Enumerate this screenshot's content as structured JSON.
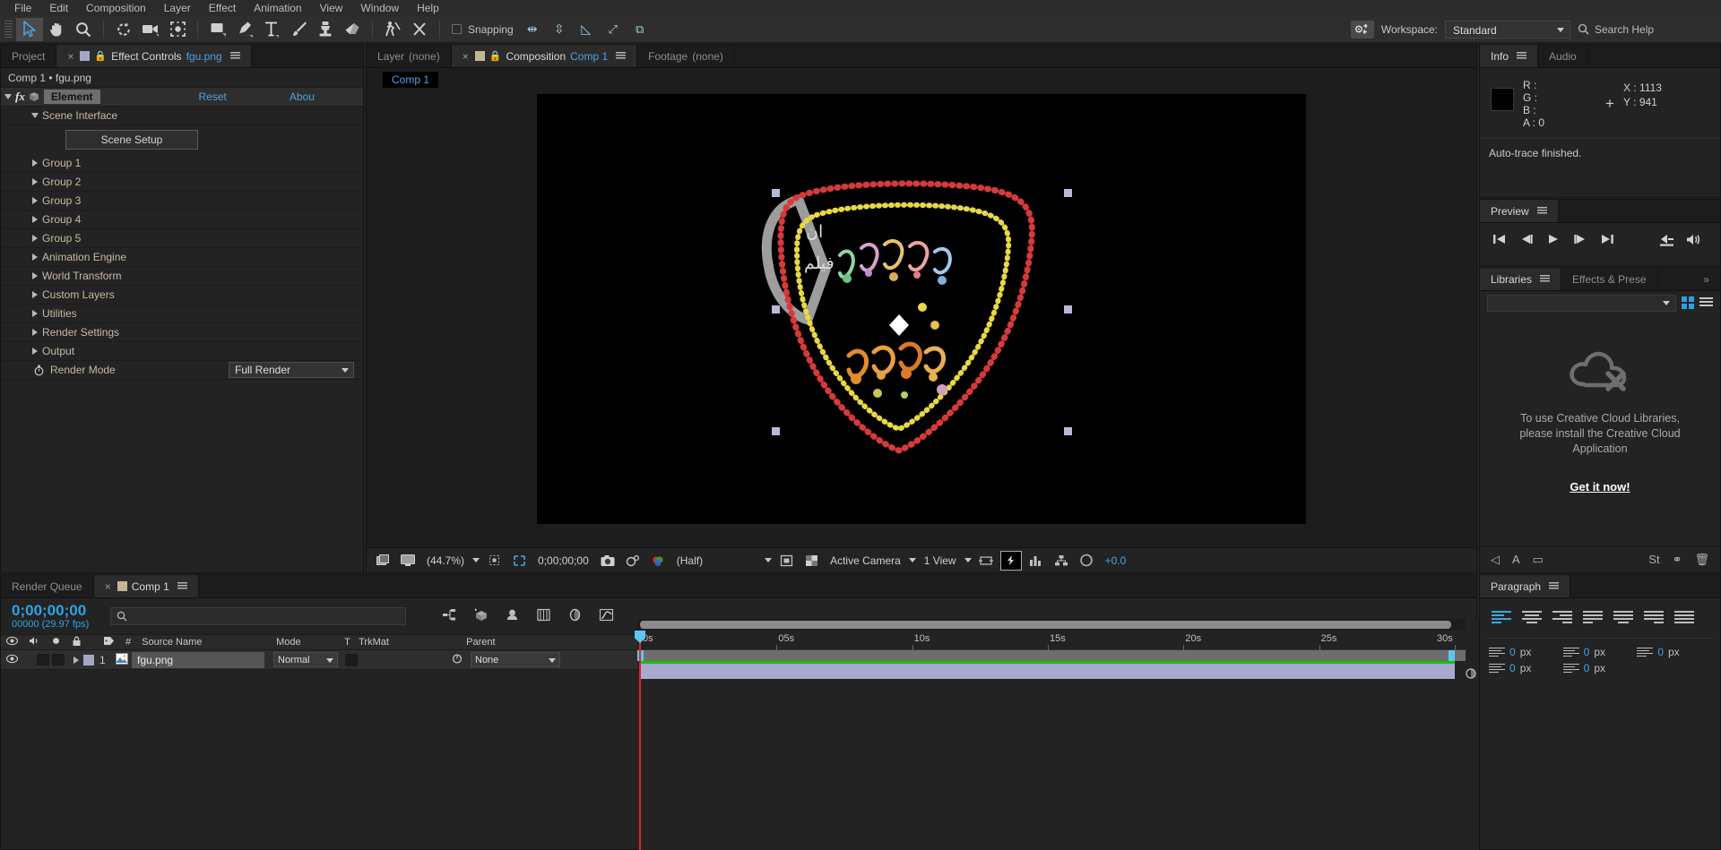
{
  "menubar": {
    "items": [
      "File",
      "Edit",
      "Composition",
      "Layer",
      "Effect",
      "Animation",
      "View",
      "Window",
      "Help"
    ]
  },
  "toolbar": {
    "tools": [
      {
        "name": "selection-tool",
        "glyph": "➤",
        "selected": true
      },
      {
        "name": "hand-tool",
        "glyph": "✋",
        "selected": false
      },
      {
        "name": "zoom-tool",
        "glyph": "🔍",
        "selected": false
      },
      {
        "name": "rotation-tool",
        "glyph": "↻",
        "selected": false
      },
      {
        "name": "camera-tool",
        "glyph": "🎥",
        "selected": false
      },
      {
        "name": "pan-behind-tool",
        "glyph": "⛶",
        "selected": false
      },
      {
        "name": "shape-tool",
        "glyph": "▭",
        "selected": false
      },
      {
        "name": "pen-tool",
        "glyph": "✒",
        "selected": false
      },
      {
        "name": "type-tool",
        "glyph": "T",
        "selected": false
      },
      {
        "name": "brush-tool",
        "glyph": "🖌",
        "selected": false
      },
      {
        "name": "clone-stamp-tool",
        "glyph": "⬍",
        "selected": false
      },
      {
        "name": "eraser-tool",
        "glyph": "▰",
        "selected": false
      },
      {
        "name": "roto-brush-tool",
        "glyph": "🏃",
        "selected": false
      },
      {
        "name": "puppet-pin-tool",
        "glyph": "✛",
        "selected": false
      }
    ],
    "snapping_label": "Snapping",
    "align_tools": [
      {
        "name": "align-tool",
        "glyph": "⇹"
      },
      {
        "name": "distribute-tool",
        "glyph": "⇳"
      },
      {
        "name": "mask-tool",
        "glyph": "◺"
      }
    ],
    "snap_extra": [
      {
        "name": "snap-to-grid-icon",
        "glyph": "⤢"
      },
      {
        "name": "snap-boundaries-icon",
        "glyph": "⧉"
      }
    ],
    "workspace_label": "Workspace:",
    "workspace_value": "Standard",
    "search_placeholder": "Search Help"
  },
  "effect_controls": {
    "tabs": [
      {
        "label": "Project",
        "active": false
      },
      {
        "label": "Effect Controls",
        "suffix": "fgu.png",
        "active": true
      }
    ],
    "breadcrumb": "Comp 1 • fgu.png",
    "effect_name": "Element",
    "reset_label": "Reset",
    "about_label": "Abou",
    "scene_interface_label": "Scene Interface",
    "scene_setup_button": "Scene Setup",
    "groups": [
      "Group 1",
      "Group 2",
      "Group 3",
      "Group 4",
      "Group 5",
      "Animation Engine",
      "World Transform",
      "Custom Layers",
      "Utilities",
      "Render Settings",
      "Output"
    ],
    "render_mode_label": "Render Mode",
    "render_mode_value": "Full Render"
  },
  "composition": {
    "tabs": [
      {
        "label": "Layer",
        "suffix": "(none)",
        "active": false
      },
      {
        "label": "Composition",
        "suffix": "Comp 1",
        "active": true
      },
      {
        "label": "Footage",
        "suffix": "(none)",
        "active": false
      }
    ],
    "subtab": "Comp 1",
    "bottom_bar": {
      "zoom": "(44.7%)",
      "timecode": "0;00;00;00",
      "resolution": "(Half)",
      "camera": "Active Camera",
      "views": "1 View",
      "exposure": "+0.0"
    }
  },
  "info": {
    "tabs": [
      {
        "label": "Info",
        "active": true
      },
      {
        "label": "Audio",
        "active": false
      }
    ],
    "channels": [
      {
        "key": "R :",
        "value": ""
      },
      {
        "key": "G :",
        "value": ""
      },
      {
        "key": "B :",
        "value": ""
      },
      {
        "key": "A :",
        "value": "0"
      }
    ],
    "x_label": "X :",
    "x_value": "1113",
    "y_label": "Y :",
    "y_value": "941",
    "status": "Auto-trace finished."
  },
  "preview": {
    "title": "Preview",
    "controls": [
      {
        "name": "first-frame-button",
        "glyph": "|◀"
      },
      {
        "name": "previous-frame-button",
        "glyph": "◀|"
      },
      {
        "name": "play-button",
        "glyph": "▶"
      },
      {
        "name": "next-frame-button",
        "glyph": "|▶"
      },
      {
        "name": "last-frame-button",
        "glyph": "▶|"
      },
      {
        "name": "ram-preview-button",
        "glyph": "⏏"
      },
      {
        "name": "audio-toggle-button",
        "glyph": "🔊"
      }
    ]
  },
  "libraries": {
    "tabs": [
      {
        "label": "Libraries",
        "active": true
      },
      {
        "label": "Effects & Prese",
        "active": false
      }
    ],
    "overflow": "»",
    "message_line1": "To use Creative Cloud Libraries,",
    "message_line2": "please install the Creative Cloud",
    "message_line3": "Application",
    "link": "Get it now!",
    "footer_icons": [
      {
        "name": "audio-footer-icon",
        "glyph": "◁"
      },
      {
        "name": "text-footer-icon",
        "glyph": "A"
      },
      {
        "name": "rect-footer-icon",
        "glyph": "▭"
      },
      {
        "name": "stock-footer-icon",
        "glyph": "St"
      },
      {
        "name": "link-footer-icon",
        "glyph": "⚭"
      },
      {
        "name": "delete-footer-icon",
        "glyph": "🗑"
      }
    ]
  },
  "paragraph": {
    "title": "Paragraph",
    "alignments": [
      {
        "name": "align-left",
        "active": true
      },
      {
        "name": "align-center",
        "active": false
      },
      {
        "name": "align-right",
        "active": false
      },
      {
        "name": "justify-last-left",
        "active": false
      },
      {
        "name": "justify-last-center",
        "active": false
      },
      {
        "name": "justify-last-right",
        "active": false
      },
      {
        "name": "justify-all",
        "active": false
      }
    ],
    "fields": [
      {
        "name": "indent-left",
        "value": "0",
        "unit": "px"
      },
      {
        "name": "space-before",
        "value": "0",
        "unit": "px"
      },
      {
        "name": "indent-first-line",
        "value": "0",
        "unit": "px"
      },
      {
        "name": "indent-right",
        "value": "0",
        "unit": "px"
      },
      {
        "name": "space-after",
        "value": "0",
        "unit": "px"
      }
    ]
  },
  "timeline": {
    "tabs": [
      {
        "label": "Render Queue",
        "active": false
      },
      {
        "label": "Comp 1",
        "active": true
      }
    ],
    "timecode": "0;00;00;00",
    "frame_info": "00000 (29.97 fps)",
    "search_placeholder": "",
    "columns": [
      "#",
      "Source Name",
      "Mode",
      "T",
      "TrkMat",
      "Parent"
    ],
    "layers": [
      {
        "index": "1",
        "source_name": "fgu.png",
        "mode": "Normal",
        "trkmat": "",
        "parent": "None"
      }
    ],
    "ruler_ticks": [
      "0s",
      "05s",
      "10s",
      "15s",
      "20s",
      "25s",
      "30s"
    ]
  },
  "colors": {
    "accent_blue": "#2fa3e6",
    "panel_bg": "#232323",
    "tab_bg": "#1c1c1c",
    "layer_bar": "#a9a9cf",
    "work_area_cap": "#5bc8f0",
    "playhead": "#e02424",
    "green_bar": "#12c400"
  }
}
